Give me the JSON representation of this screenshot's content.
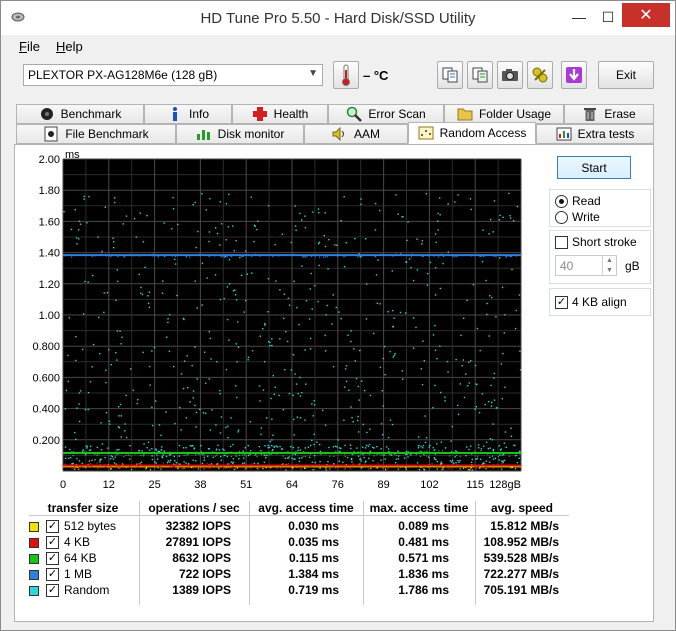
{
  "window": {
    "title": "HD Tune Pro 5.50 - Hard Disk/SSD Utility"
  },
  "menu": {
    "file_first": "F",
    "file_rest": "ile",
    "help_first": "H",
    "help_rest": "elp"
  },
  "toolbar": {
    "drive": "PLEXTOR PX-AG128M6e (128 gB)",
    "temperature": "– °C",
    "exit_label": "Exit"
  },
  "tabs_row1": [
    "Benchmark",
    "Info",
    "Health",
    "Error Scan",
    "Folder Usage",
    "Erase"
  ],
  "tabs_row2": [
    "File Benchmark",
    "Disk monitor",
    "AAM",
    "Random Access",
    "Extra tests"
  ],
  "active_tab": "Random Access",
  "controls": {
    "start_label": "Start",
    "read_label": "Read",
    "write_label": "Write",
    "mode_selected": "Read",
    "short_stroke_label": "Short stroke",
    "short_stroke_checked": false,
    "stroke_value": "40",
    "stroke_unit": "gB",
    "align_label": "4 KB align",
    "align_checked": true
  },
  "results": {
    "headers": [
      "transfer size",
      "operations / sec",
      "avg. access time",
      "max. access time",
      "avg. speed"
    ],
    "rows": [
      {
        "size": "512 bytes",
        "ops": "32382 IOPS",
        "avg": "0.030 ms",
        "max": "0.089 ms",
        "speed": "15.812 MB/s",
        "color": "#f2e400"
      },
      {
        "size": "4 KB",
        "ops": "27891 IOPS",
        "avg": "0.035 ms",
        "max": "0.481 ms",
        "speed": "108.952 MB/s",
        "color": "#e01010"
      },
      {
        "size": "64 KB",
        "ops": "8632 IOPS",
        "avg": "0.115 ms",
        "max": "0.571 ms",
        "speed": "539.528 MB/s",
        "color": "#17c417"
      },
      {
        "size": "1 MB",
        "ops": "722 IOPS",
        "avg": "1.384 ms",
        "max": "1.836 ms",
        "speed": "722.277 MB/s",
        "color": "#2f7fe0"
      },
      {
        "size": "Random",
        "ops": "1389 IOPS",
        "avg": "0.719 ms",
        "max": "1.786 ms",
        "speed": "705.191 MB/s",
        "color": "#2fd6d6"
      }
    ]
  },
  "chart_data": {
    "type": "scatter",
    "ylabel": "ms",
    "xlabel": "",
    "y_ticks": [
      "2.00",
      "1.80",
      "1.60",
      "1.40",
      "1.20",
      "1.00",
      "0.800",
      "0.600",
      "0.400",
      "0.200"
    ],
    "x_ticks": [
      "0",
      "12",
      "25",
      "38",
      "51",
      "64",
      "76",
      "89",
      "102",
      "115",
      "128gB"
    ],
    "xlim": [
      0,
      128
    ],
    "ylim": [
      0,
      2.0
    ],
    "grid": true,
    "series": [
      {
        "name": "512 bytes",
        "level_ms": 0.03,
        "color": "#f2e400"
      },
      {
        "name": "4 KB",
        "level_ms": 0.035,
        "color": "#e01010"
      },
      {
        "name": "64 KB",
        "level_ms": 0.115,
        "color": "#17c417"
      },
      {
        "name": "1 MB",
        "level_ms": 1.384,
        "color": "#2f7fe0"
      },
      {
        "name": "Random",
        "level_ms": 0.719,
        "max_ms": 1.786,
        "color": "#2fd6d6"
      }
    ]
  }
}
